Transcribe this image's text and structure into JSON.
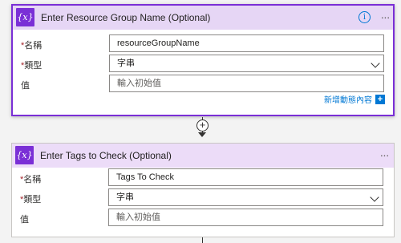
{
  "steps": [
    {
      "icon": "{x}",
      "icon_name": "variable-icon",
      "title": "Enter Resource Group Name (Optional)",
      "fields": {
        "name": {
          "label": "名稱",
          "required": true,
          "value": "resourceGroupName"
        },
        "type": {
          "label": "類型",
          "required": true,
          "value": "字串"
        },
        "value": {
          "label": "值",
          "required": false,
          "placeholder": "輸入初始值"
        }
      },
      "add_dynamic_label": "新增動態內容",
      "add_dynamic_icon": "+"
    },
    {
      "icon": "{x}",
      "icon_name": "variable-icon",
      "title": "Enter Tags to Check (Optional)",
      "fields": {
        "name": {
          "label": "名稱",
          "required": true,
          "value": "Tags To Check"
        },
        "type": {
          "label": "類型",
          "required": true,
          "value": "字串"
        },
        "value": {
          "label": "值",
          "required": false,
          "placeholder": "輸入初始值"
        }
      }
    }
  ],
  "info_icon": "i",
  "more_icon": "···",
  "add_step_icon": "+",
  "required_marker": "*",
  "colors": {
    "accent": "#7a2fd6",
    "header_bg": "#e6d6f5",
    "link": "#0078d4",
    "required": "#a4262c"
  }
}
